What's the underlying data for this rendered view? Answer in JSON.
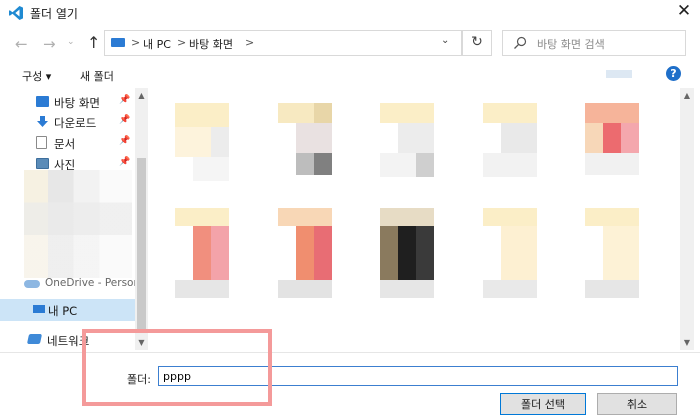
{
  "window": {
    "title": "폴더 열기",
    "close_glyph": "✕"
  },
  "nav": {
    "back_glyph": "←",
    "forward_glyph": "→",
    "recent_glyph": "⌄",
    "up_glyph": "↑",
    "breadcrumb": [
      "내 PC",
      "바탕 화면"
    ],
    "separator": ">",
    "dropdown_glyph": "⌄",
    "refresh_glyph": "↻",
    "search_placeholder": "바탕 화면 검색"
  },
  "toolbar": {
    "organize": "구성 ▾",
    "new_folder": "새 폴더",
    "help": "?"
  },
  "sidebar": {
    "quick_access": [
      {
        "label": "바탕 화면",
        "icon": "desktop-icon",
        "color": "#2b7bd4"
      },
      {
        "label": "다운로드",
        "icon": "download-icon",
        "color": "#2b7bd4"
      },
      {
        "label": "문서",
        "icon": "document-icon",
        "color": "#8a8a8a"
      },
      {
        "label": "사진",
        "icon": "pictures-icon",
        "color": "#5a8bb8"
      }
    ],
    "pin_glyph": "📌",
    "onedrive": "OneDrive - Person",
    "this_pc": "내 PC",
    "network": "네트워크"
  },
  "bottom": {
    "folder_label": "폴더:",
    "folder_value": "pppp",
    "select_button": "폴더 선택",
    "cancel_button": "취소"
  },
  "colors": {
    "accent": "#0078d7",
    "highlight": "#f49a9a",
    "selection": "#cce4f7"
  }
}
